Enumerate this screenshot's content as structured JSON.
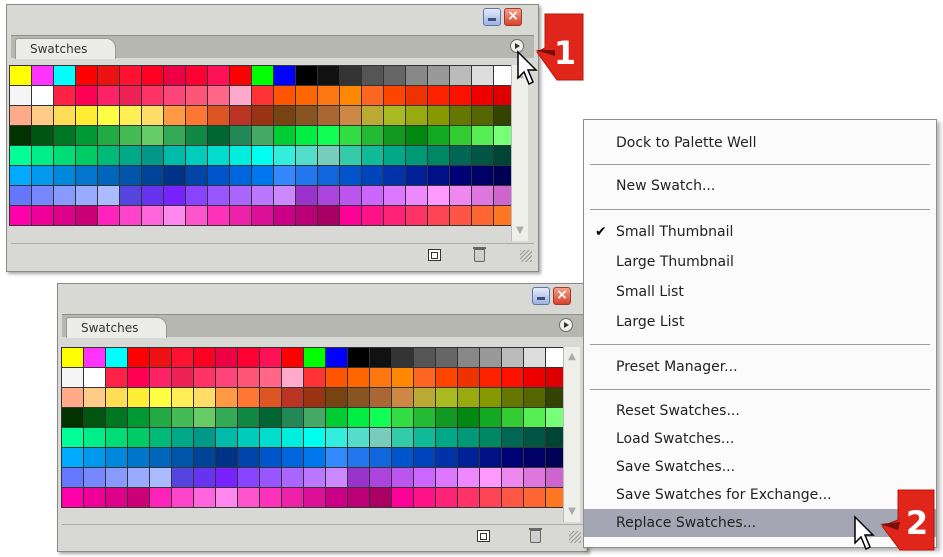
{
  "panel_top": {
    "tab_label": "Swatches",
    "close_glyph": "×",
    "menu_button_icon": "flyout-menu-icon",
    "new_swatch_icon": "new-swatch-icon",
    "delete_icon": "trash-icon"
  },
  "panel_bottom": {
    "tab_label": "Swatches",
    "close_glyph": "×",
    "menu_button_icon": "flyout-menu-icon",
    "new_swatch_icon": "new-swatch-icon",
    "delete_icon": "trash-icon"
  },
  "swatch_rows": [
    [
      "#ffff00",
      "#ff33ff",
      "#00ffff",
      "#ff0000",
      "#ee1111",
      "#ff1133",
      "#ff0022",
      "#ee0044",
      "#ff0033",
      "#ff1155",
      "#ff0000",
      "#00ff00",
      "#0000ff",
      "#000000",
      "#111111",
      "#333333",
      "#555555",
      "#666666",
      "#888888",
      "#999999",
      "#bbbbbb",
      "#dddddd",
      "#ffffff"
    ],
    [
      "#f5f5f5",
      "#ffffff",
      "#ff2244",
      "#ff0055",
      "#ff2266",
      "#ee2255",
      "#ff3366",
      "#ff4477",
      "#ff5577",
      "#ff6688",
      "#ffaacc",
      "#ff3333",
      "#ff5500",
      "#ff6600",
      "#ff7711",
      "#ff8800",
      "#ff6622",
      "#ff4400",
      "#ee3300",
      "#ff2200",
      "#ff1100",
      "#ee0000",
      "#dd0000"
    ],
    [
      "#ffaa88",
      "#ffcc88",
      "#ffdd55",
      "#ffee33",
      "#ffff44",
      "#ffee55",
      "#ffdd66",
      "#ff9944",
      "#ff7733",
      "#dd5522",
      "#bb3322",
      "#993311",
      "#774411",
      "#885522",
      "#aa6633",
      "#cc8844",
      "#bbaa33",
      "#aabb22",
      "#99aa11",
      "#889900",
      "#667700",
      "#556600",
      "#334400"
    ],
    [
      "#003300",
      "#005511",
      "#007722",
      "#009933",
      "#22aa44",
      "#44bb55",
      "#66cc66",
      "#33aa55",
      "#118844",
      "#006633",
      "#228855",
      "#44aa66",
      "#00cc33",
      "#00ee44",
      "#11ff55",
      "#33dd44",
      "#22bb33",
      "#119922",
      "#008811",
      "#11aa22",
      "#33cc33",
      "#55ee55",
      "#77ff77"
    ],
    [
      "#00ff99",
      "#00ee88",
      "#00dd77",
      "#00cc66",
      "#00bb77",
      "#00aa88",
      "#009988",
      "#00bbaa",
      "#00ccbb",
      "#00ddcc",
      "#00eedd",
      "#00ffee",
      "#33eedd",
      "#55ddcc",
      "#77ccbb",
      "#33ccaa",
      "#11bb99",
      "#00aa88",
      "#009977",
      "#008866",
      "#006655",
      "#005544",
      "#004433"
    ],
    [
      "#00aaff",
      "#0099ee",
      "#0088dd",
      "#0077cc",
      "#0066bb",
      "#0055aa",
      "#004499",
      "#003388",
      "#0044aa",
      "#0055cc",
      "#0066dd",
      "#0077ee",
      "#3388ff",
      "#2277ee",
      "#1166dd",
      "#0055cc",
      "#0044bb",
      "#0033aa",
      "#002299",
      "#001188",
      "#000077",
      "#000066",
      "#000055"
    ],
    [
      "#6677ff",
      "#7788ff",
      "#8899ff",
      "#99aaff",
      "#aabbff",
      "#5544dd",
      "#6633ee",
      "#7722ff",
      "#8844ff",
      "#9955ff",
      "#aa66ff",
      "#bb77ff",
      "#cc88ff",
      "#9933cc",
      "#aa44dd",
      "#bb55ee",
      "#cc66ff",
      "#dd77ff",
      "#ee88ff",
      "#ff99ff",
      "#ee88ee",
      "#dd77dd",
      "#cc66cc"
    ],
    [
      "#ff00aa",
      "#ee0099",
      "#dd0088",
      "#cc0077",
      "#ff22bb",
      "#ff44cc",
      "#ff66dd",
      "#ff88ee",
      "#ff55cc",
      "#ff33bb",
      "#ee22aa",
      "#dd1199",
      "#cc0088",
      "#bb0077",
      "#aa0066",
      "#ff0099",
      "#ff1188",
      "#ff2277",
      "#ff3366",
      "#ff4455",
      "#ff5544",
      "#ff6633",
      "#ff7722"
    ]
  ],
  "menu": {
    "items": [
      {
        "label": "Dock to Palette Well"
      },
      {
        "label": "New Swatch..."
      },
      {
        "label": "Small Thumbnail",
        "check": "✔"
      },
      {
        "label": "Large Thumbnail"
      },
      {
        "label": "Small List"
      },
      {
        "label": "Large List"
      },
      {
        "label": "Preset Manager..."
      },
      {
        "label": "Reset Swatches..."
      },
      {
        "label": "Load Swatches..."
      },
      {
        "label": "Save Swatches..."
      },
      {
        "label": "Save Swatches for Exchange..."
      },
      {
        "label": "Replace Swatches..."
      }
    ],
    "highlighted_label": "Replace Swatches...",
    "highlight_color": "#a4a6b4"
  },
  "badges": {
    "step1": "1",
    "step2": "2",
    "color": "#e0261b"
  }
}
